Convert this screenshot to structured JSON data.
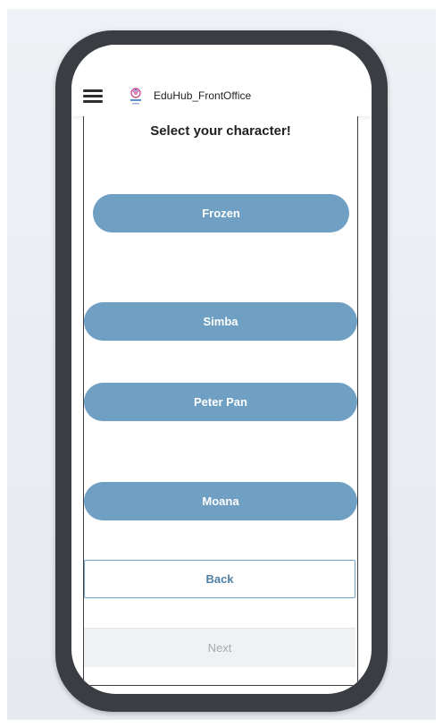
{
  "app": {
    "title": "EduHub_FrontOffice"
  },
  "page": {
    "title": "Select your character!"
  },
  "characters": [
    {
      "label": "Frozen"
    },
    {
      "label": "Simba"
    },
    {
      "label": "Peter Pan"
    },
    {
      "label": "Moana"
    }
  ],
  "navigation": {
    "back_label": "Back",
    "next_label": "Next"
  },
  "colors": {
    "accent": "#6f9fc2",
    "phone_frame": "#3a3e42",
    "disabled_bg": "#f0f1f3"
  },
  "icons": {
    "menu": "hamburger-menu-icon",
    "logo": "app-logo-icon"
  }
}
